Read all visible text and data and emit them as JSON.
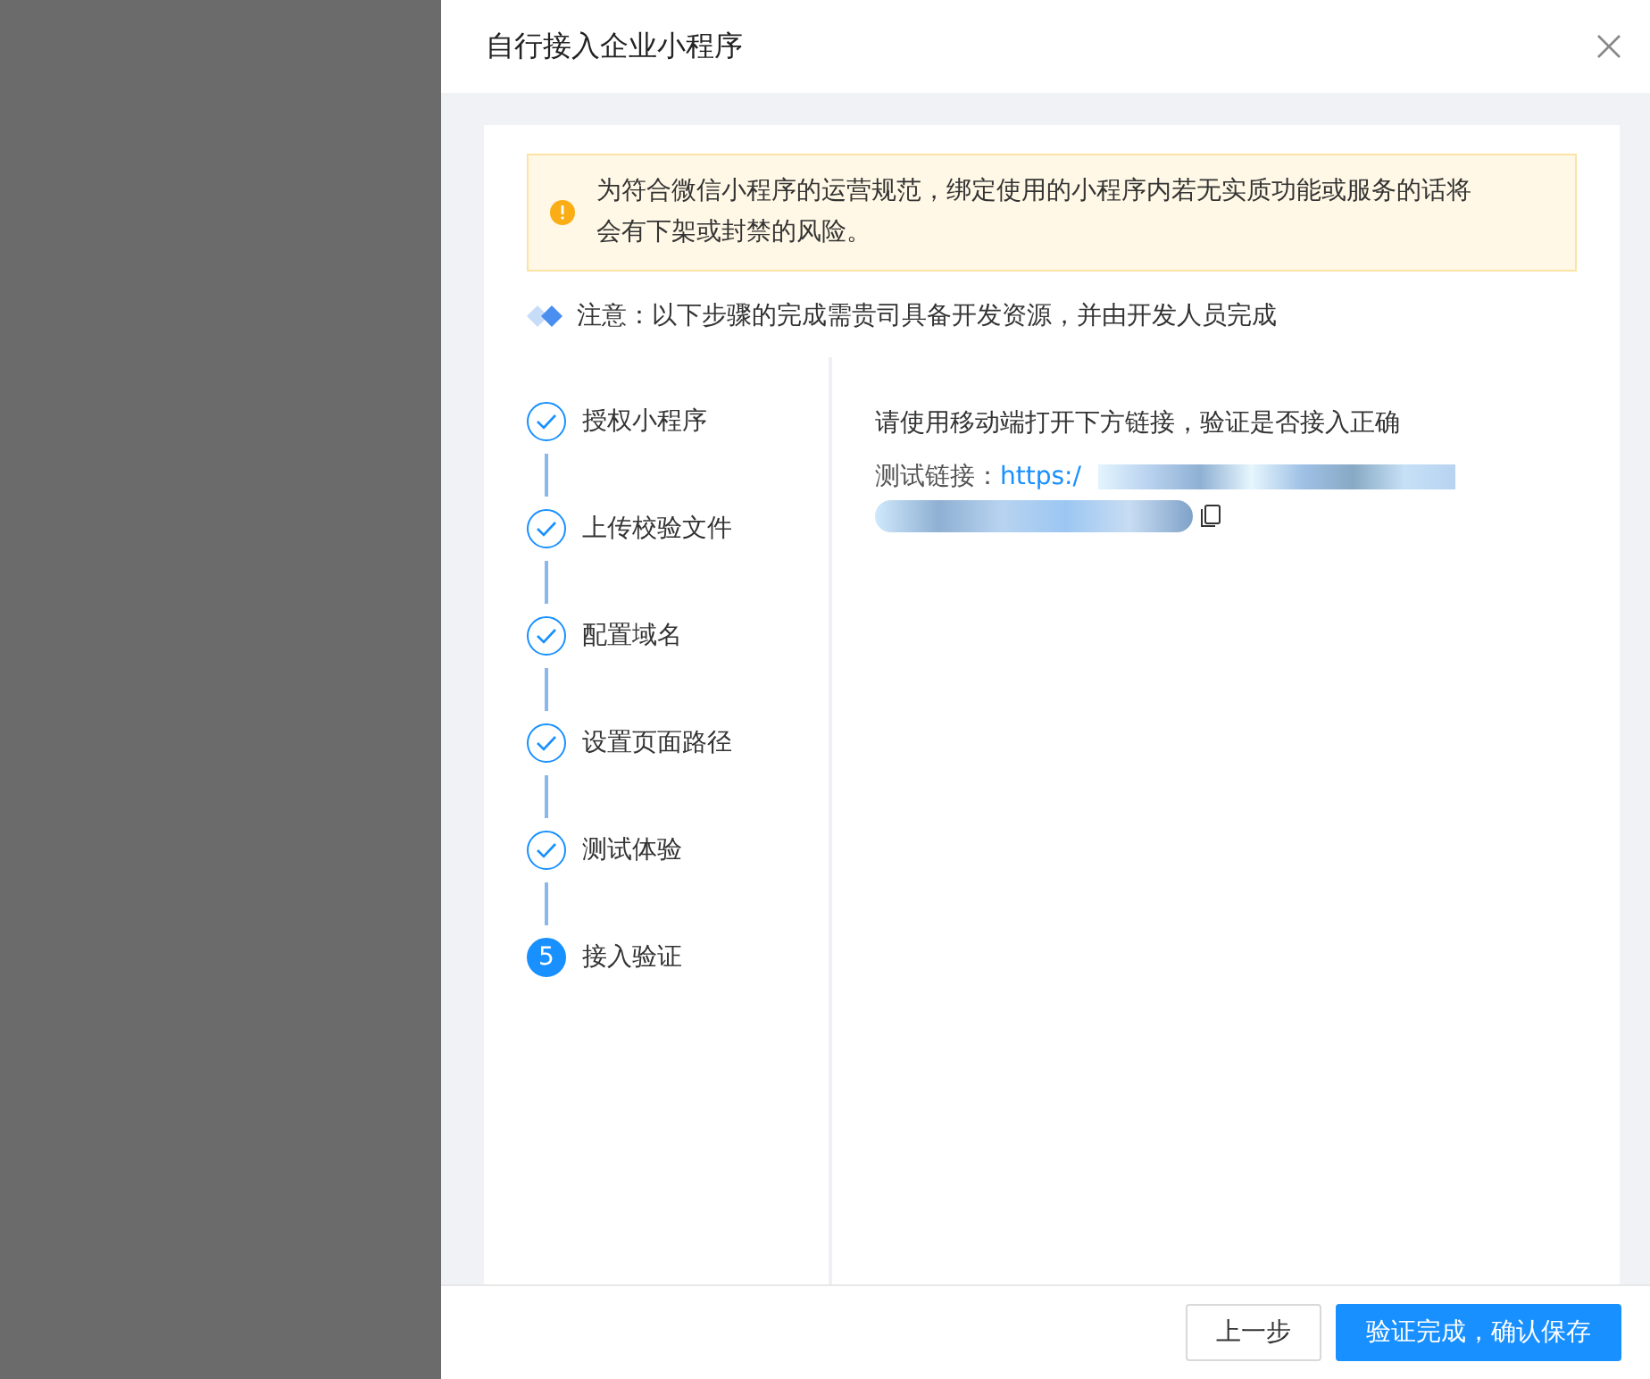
{
  "drawer": {
    "title": "自行接入企业小程序"
  },
  "alert": {
    "text": "为符合微信小程序的运营规范，绑定使用的小程序内若无实质功能或服务的话将会有下架或封禁的风险。"
  },
  "notice": {
    "text": "注意：以下步骤的完成需贵司具备开发资源，并由开发人员完成"
  },
  "steps": [
    {
      "label": "授权小程序",
      "kind": "done"
    },
    {
      "label": "上传校验文件",
      "kind": "done"
    },
    {
      "label": "配置域名",
      "kind": "done"
    },
    {
      "label": "设置页面路径",
      "kind": "done"
    },
    {
      "label": "测试体验",
      "kind": "done"
    },
    {
      "label": "接入验证",
      "kind": "current",
      "number": "5"
    }
  ],
  "content": {
    "instruction": "请使用移动端打开下方链接，验证是否接入正确",
    "link_label": "测试链接：",
    "link": "https:/"
  },
  "buttons": [
    {
      "label": "上一步",
      "kind": "default"
    },
    {
      "label": "验证完成，确认保存",
      "kind": "primary"
    }
  ]
}
